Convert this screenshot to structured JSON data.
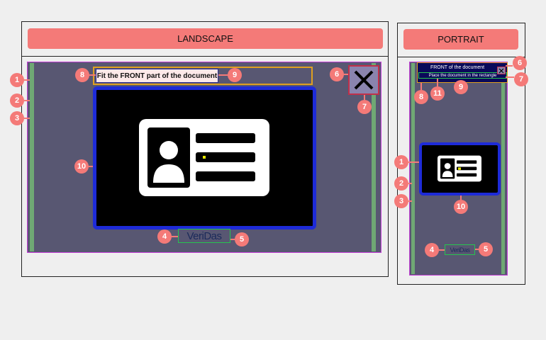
{
  "landscape": {
    "tab_label": "LANDSCAPE",
    "banner_text": "Fit the FRONT part of the document",
    "logo_text": "VeriDas",
    "close_icon": "close-icon",
    "id_card_icon": "id-card-icon"
  },
  "portrait": {
    "tab_label": "PORTRAIT",
    "banner_title": "FRONT of the document",
    "banner_subtitle": "Place the document in the rectangle",
    "logo_text": "VeriDas",
    "close_icon": "close-icon",
    "id_card_icon": "id-card-icon"
  },
  "markers": [
    "1",
    "2",
    "3",
    "4",
    "5",
    "6",
    "7",
    "8",
    "9",
    "10",
    "11"
  ],
  "colors": {
    "marker": "#f47a78",
    "screen": "#585772",
    "frame_border": "#1e2bd8",
    "banner_outline": "#e0a020",
    "stripe": "#6fa874",
    "magenta_outline": "#c33fd6",
    "logo_outline": "#27c44f"
  }
}
